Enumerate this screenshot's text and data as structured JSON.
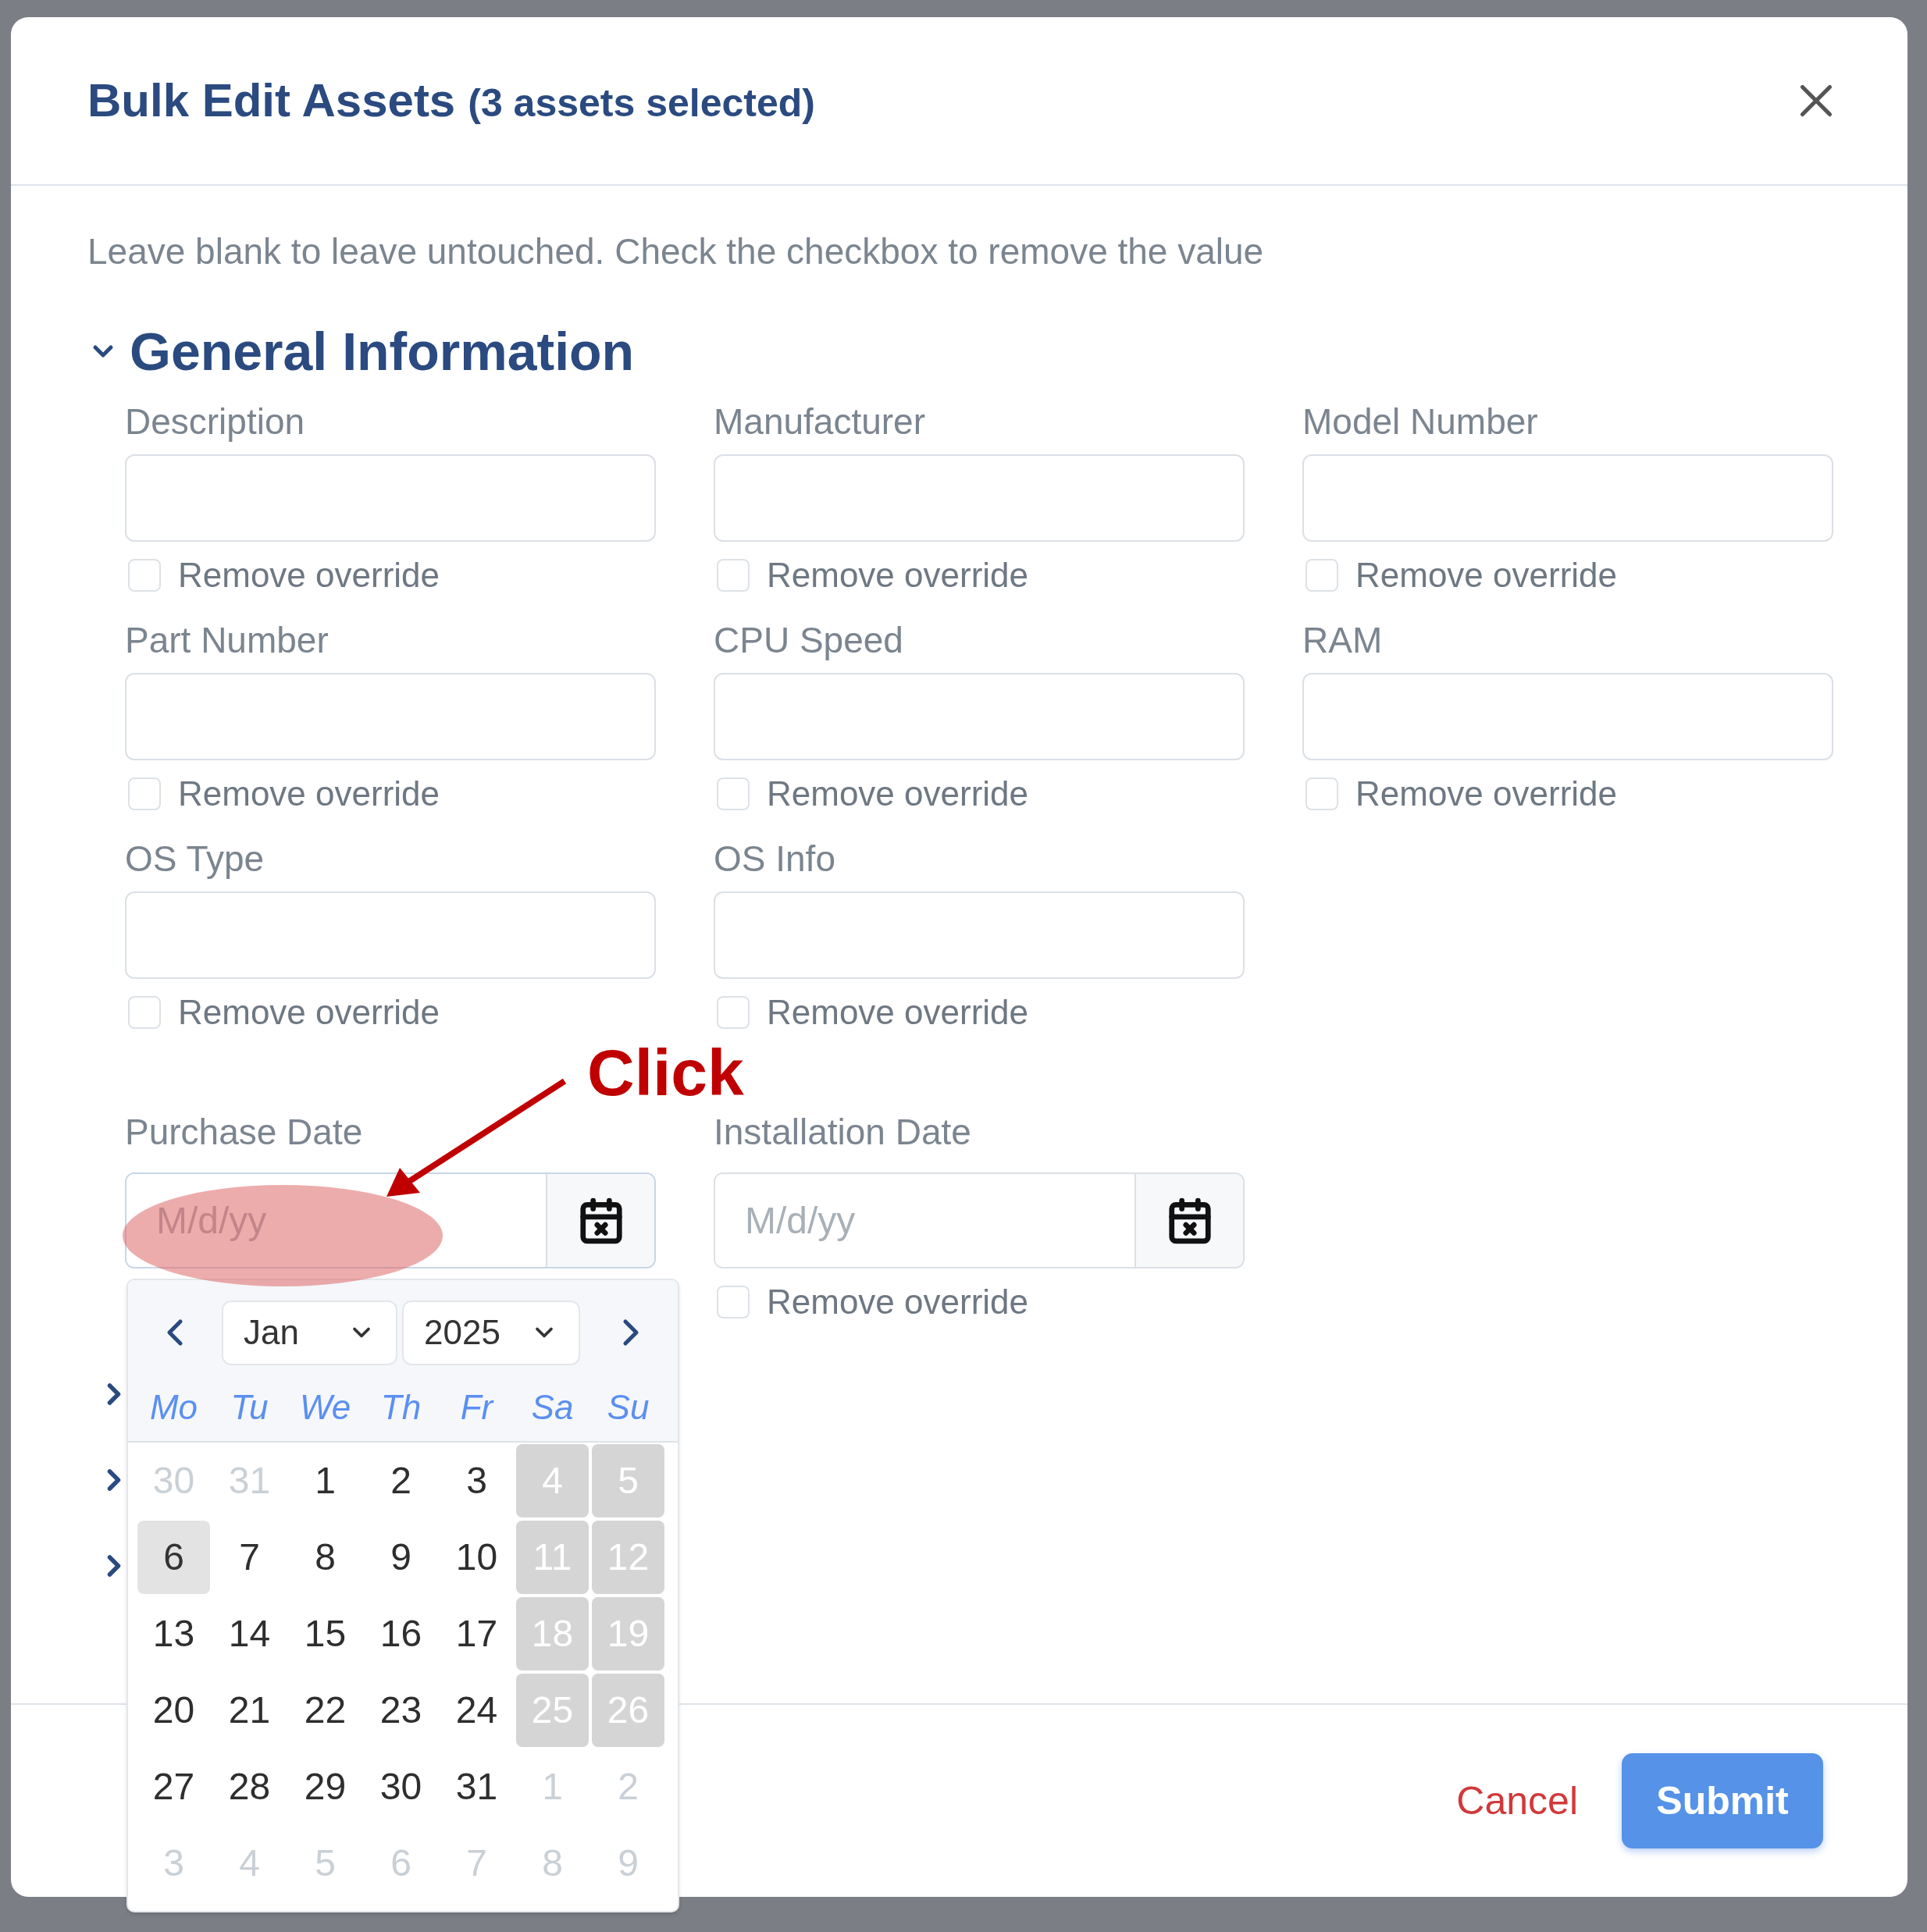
{
  "dialog": {
    "title": "Bulk Edit Assets",
    "subtitle": "(3 assets selected)"
  },
  "hint": "Leave blank to leave untouched. Check the checkbox to remove the value",
  "section": {
    "title": "General Information",
    "expanded": true
  },
  "fields": [
    {
      "label": "Description",
      "remove_label": "Remove override",
      "checked": false
    },
    {
      "label": "Manufacturer",
      "remove_label": "Remove override",
      "checked": false
    },
    {
      "label": "Model Number",
      "remove_label": "Remove override",
      "checked": false
    },
    {
      "label": "Part Number",
      "remove_label": "Remove override",
      "checked": false
    },
    {
      "label": "CPU Speed",
      "remove_label": "Remove override",
      "checked": false
    },
    {
      "label": "RAM",
      "remove_label": "Remove override",
      "checked": false
    },
    {
      "label": "OS Type",
      "remove_label": "Remove override",
      "checked": false
    },
    {
      "label": "OS Info",
      "remove_label": "Remove override",
      "checked": false
    }
  ],
  "date_fields": [
    {
      "label": "Purchase Date",
      "placeholder": "M/d/yy",
      "picker_open": true
    },
    {
      "label": "Installation Date",
      "placeholder": "M/d/yy",
      "picker_open": false,
      "remove_label": "Remove override",
      "checked": false
    }
  ],
  "date_picker": {
    "month": "Jan",
    "year": "2025",
    "weekdays": [
      "Mo",
      "Tu",
      "We",
      "Th",
      "Fr",
      "Sa",
      "Su"
    ],
    "weeks": [
      [
        {
          "day": "30",
          "kind": "outside"
        },
        {
          "day": "31",
          "kind": "outside"
        },
        {
          "day": "1",
          "kind": "normal"
        },
        {
          "day": "2",
          "kind": "normal"
        },
        {
          "day": "3",
          "kind": "normal"
        },
        {
          "day": "4",
          "kind": "weekend"
        },
        {
          "day": "5",
          "kind": "weekend"
        }
      ],
      [
        {
          "day": "6",
          "kind": "today"
        },
        {
          "day": "7",
          "kind": "normal"
        },
        {
          "day": "8",
          "kind": "normal"
        },
        {
          "day": "9",
          "kind": "normal"
        },
        {
          "day": "10",
          "kind": "normal"
        },
        {
          "day": "11",
          "kind": "weekend"
        },
        {
          "day": "12",
          "kind": "weekend"
        }
      ],
      [
        {
          "day": "13",
          "kind": "normal"
        },
        {
          "day": "14",
          "kind": "normal"
        },
        {
          "day": "15",
          "kind": "normal"
        },
        {
          "day": "16",
          "kind": "normal"
        },
        {
          "day": "17",
          "kind": "normal"
        },
        {
          "day": "18",
          "kind": "weekend"
        },
        {
          "day": "19",
          "kind": "weekend"
        }
      ],
      [
        {
          "day": "20",
          "kind": "normal"
        },
        {
          "day": "21",
          "kind": "normal"
        },
        {
          "day": "22",
          "kind": "normal"
        },
        {
          "day": "23",
          "kind": "normal"
        },
        {
          "day": "24",
          "kind": "normal"
        },
        {
          "day": "25",
          "kind": "weekend"
        },
        {
          "day": "26",
          "kind": "weekend"
        }
      ],
      [
        {
          "day": "27",
          "kind": "normal"
        },
        {
          "day": "28",
          "kind": "normal"
        },
        {
          "day": "29",
          "kind": "normal"
        },
        {
          "day": "30",
          "kind": "normal"
        },
        {
          "day": "31",
          "kind": "normal"
        },
        {
          "day": "1",
          "kind": "outside"
        },
        {
          "day": "2",
          "kind": "outside"
        }
      ],
      [
        {
          "day": "3",
          "kind": "outside"
        },
        {
          "day": "4",
          "kind": "outside"
        },
        {
          "day": "5",
          "kind": "outside"
        },
        {
          "day": "6",
          "kind": "outside"
        },
        {
          "day": "7",
          "kind": "outside"
        },
        {
          "day": "8",
          "kind": "outside"
        },
        {
          "day": "9",
          "kind": "outside"
        }
      ]
    ]
  },
  "collapsed_sections": [
    {
      "expanded": false
    },
    {
      "expanded": false
    },
    {
      "expanded": false
    }
  ],
  "footer": {
    "cancel": "Cancel",
    "submit": "Submit"
  },
  "annotation": {
    "text": "Click"
  }
}
